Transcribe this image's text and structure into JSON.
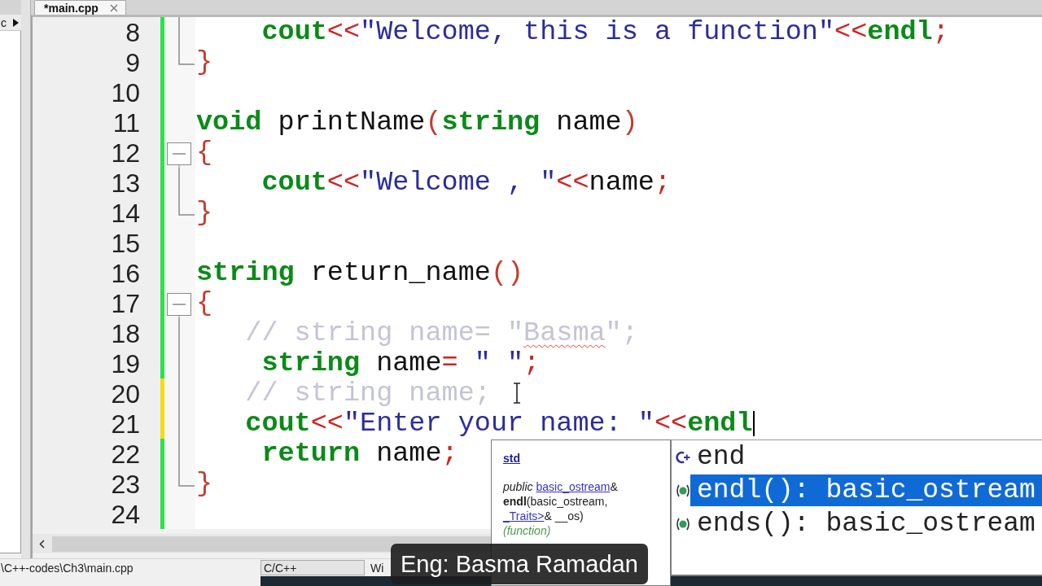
{
  "left_panel": {
    "tab_label": "c"
  },
  "tabs": [
    {
      "label": "*main.cpp",
      "selected": true
    }
  ],
  "editor": {
    "lines": [
      {
        "number": "8",
        "kind": "fold_body",
        "unsaved": false,
        "caret": false,
        "code": [
          {
            "kind": "keyword",
            "text": "    cout"
          },
          {
            "kind": "operator",
            "text": "<<"
          },
          {
            "kind": "string",
            "text": "\"Welcome, this is a function\""
          },
          {
            "kind": "operator",
            "text": "<<"
          },
          {
            "kind": "keyword",
            "text": "endl"
          },
          {
            "kind": "operator",
            "text": ";"
          }
        ]
      },
      {
        "number": "9",
        "kind": "fold_end",
        "unsaved": false,
        "caret": false,
        "code": [
          {
            "kind": "brace",
            "text": "}"
          }
        ]
      },
      {
        "number": "10",
        "kind": "plain",
        "unsaved": false,
        "caret": false
      },
      {
        "number": "11",
        "kind": "plain",
        "unsaved": false,
        "caret": false,
        "code": [
          {
            "kind": "keyword",
            "text": "void"
          },
          {
            "kind": "plain",
            "text": " printName"
          },
          {
            "kind": "brace",
            "text": "("
          },
          {
            "kind": "keyword",
            "text": "string"
          },
          {
            "kind": "plain",
            "text": " name"
          },
          {
            "kind": "brace",
            "text": ")"
          }
        ]
      },
      {
        "number": "12",
        "kind": "fold_start",
        "unsaved": false,
        "caret": false,
        "code": [
          {
            "kind": "brace",
            "text": "{"
          }
        ]
      },
      {
        "number": "13",
        "kind": "fold_body",
        "unsaved": false,
        "caret": false,
        "code": [
          {
            "kind": "keyword",
            "text": "    cout"
          },
          {
            "kind": "operator",
            "text": "<<"
          },
          {
            "kind": "string",
            "text": "\"Welcome , \""
          },
          {
            "kind": "operator",
            "text": "<<"
          },
          {
            "kind": "plain",
            "text": "name"
          },
          {
            "kind": "operator",
            "text": ";"
          }
        ]
      },
      {
        "number": "14",
        "kind": "fold_end",
        "unsaved": false,
        "caret": false,
        "code": [
          {
            "kind": "brace",
            "text": "}"
          }
        ]
      },
      {
        "number": "15",
        "kind": "plain",
        "unsaved": false,
        "caret": false
      },
      {
        "number": "16",
        "kind": "plain",
        "unsaved": false,
        "caret": false,
        "code": [
          {
            "kind": "keyword",
            "text": "string"
          },
          {
            "kind": "plain",
            "text": " return_name"
          },
          {
            "kind": "brace",
            "text": "()"
          }
        ]
      },
      {
        "number": "17",
        "kind": "fold_start",
        "unsaved": false,
        "caret": false,
        "code": [
          {
            "kind": "brace",
            "text": "{"
          }
        ]
      },
      {
        "number": "18",
        "kind": "fold_body",
        "unsaved": false,
        "caret": false,
        "code": [
          {
            "kind": "comment",
            "text": "   // string name= \""
          },
          {
            "kind": "comment_misspelled",
            "text": "Basma"
          },
          {
            "kind": "comment",
            "text": "\";"
          }
        ]
      },
      {
        "number": "19",
        "kind": "fold_body",
        "unsaved": false,
        "caret": false,
        "code": [
          {
            "kind": "keyword",
            "text": "    string"
          },
          {
            "kind": "plain",
            "text": " name"
          },
          {
            "kind": "operator",
            "text": "="
          },
          {
            "kind": "string",
            "text": " \" \""
          },
          {
            "kind": "operator",
            "text": ";"
          }
        ]
      },
      {
        "number": "20",
        "kind": "fold_body",
        "unsaved": true,
        "caret": false,
        "code": [
          {
            "kind": "comment",
            "text": "   // string name;"
          }
        ]
      },
      {
        "number": "21",
        "kind": "fold_body",
        "unsaved": true,
        "caret": true,
        "code": [
          {
            "kind": "keyword",
            "text": "   cout"
          },
          {
            "kind": "operator",
            "text": "<<"
          },
          {
            "kind": "string",
            "text": "\"Enter your name: \""
          },
          {
            "kind": "operator",
            "text": "<<"
          },
          {
            "kind": "keyword",
            "text": "endl"
          }
        ]
      },
      {
        "number": "22",
        "kind": "fold_body",
        "unsaved": false,
        "caret": false,
        "code": [
          {
            "kind": "keyword",
            "text": "    return"
          },
          {
            "kind": "plain",
            "text": " name"
          },
          {
            "kind": "operator",
            "text": ";"
          }
        ]
      },
      {
        "number": "23",
        "kind": "fold_end",
        "unsaved": false,
        "caret": false,
        "code": [
          {
            "kind": "brace",
            "text": "}"
          }
        ]
      },
      {
        "number": "24",
        "kind": "plain",
        "unsaved": false,
        "caret": false
      }
    ]
  },
  "doc_popup": {
    "scope": "std",
    "signature_lines": [
      [
        {
          "kind": "modifier",
          "text": "public "
        },
        {
          "kind": "link",
          "text": "basic_ostream"
        },
        {
          "kind": "plain",
          "text": "&"
        }
      ],
      [
        {
          "kind": "name",
          "text": "endl"
        },
        {
          "kind": "plain",
          "text": "(basic_ostream,"
        }
      ],
      [
        {
          "kind": "link",
          "text": "_Traits>"
        },
        {
          "kind": "plain",
          "text": "& __os)"
        }
      ]
    ],
    "symbol_kind": "(function)"
  },
  "completion": {
    "items": [
      {
        "kind": "type",
        "label": "end",
        "selected": false
      },
      {
        "kind": "function",
        "label": "endl(): basic_ostream",
        "selected": true
      },
      {
        "kind": "function",
        "label": "ends(): basic_ostream",
        "selected": false
      }
    ]
  },
  "status_bar": {
    "file_path": "\\C++-codes\\Ch3\\main.cpp",
    "language": "C/C++",
    "field_3": "Wi"
  },
  "caption": "Eng: Basma Ramadan"
}
